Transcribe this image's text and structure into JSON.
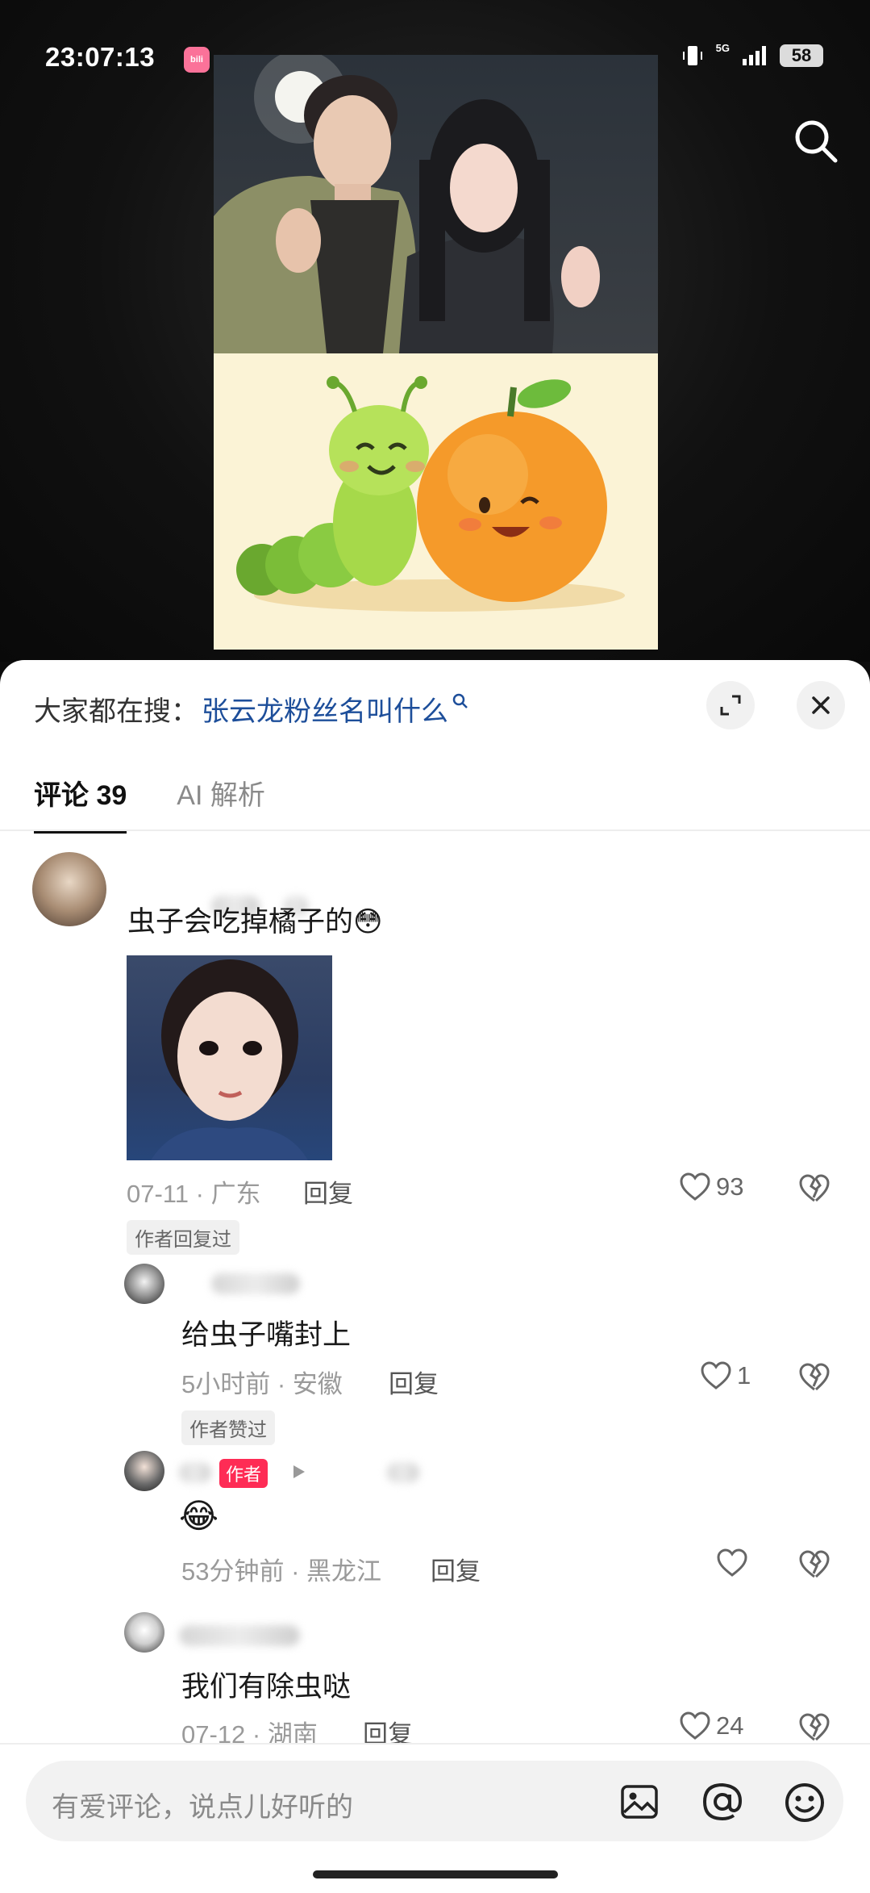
{
  "status_bar": {
    "time": "23:07:13",
    "app_badge": "bili",
    "network": "5G",
    "battery": "58"
  },
  "panel": {
    "trending_label": "大家都在搜：",
    "trending_query": "张云龙粉丝名叫什么"
  },
  "tabs": [
    {
      "label": "评论 39",
      "active": true
    },
    {
      "label": "AI 解析",
      "active": false
    }
  ],
  "comments": [
    {
      "text": "虫子会吃掉橘子的",
      "emoji": "😳",
      "time": "07-11",
      "location": "广东",
      "reply_label": "回复",
      "likes": "93",
      "tag": "作者回复过"
    }
  ],
  "replies": [
    {
      "text": "给虫子嘴封上",
      "time": "5小时前",
      "location": "安徽",
      "reply_label": "回复",
      "likes": "1",
      "tag": "作者赞过"
    },
    {
      "author_tag": "作者",
      "emoji": "😂",
      "time": "53分钟前",
      "location": "黑龙江",
      "reply_label": "回复",
      "likes": ""
    },
    {
      "text": "我们有除虫哒",
      "time": "07-12",
      "location": "湖南",
      "reply_label": "回复",
      "likes": "24"
    }
  ],
  "input": {
    "placeholder": "有爱评论，说点儿好听的"
  },
  "icons": {
    "search": "search-icon",
    "expand": "expand-icon",
    "close": "close-icon",
    "like": "heart-icon",
    "dislike": "broken-heart-icon",
    "image": "image-icon",
    "mention": "at-icon",
    "emoji": "emoji-icon"
  },
  "colors": {
    "accent": "#fe2c55",
    "link": "#1d4e9a",
    "badge": "#fb7299"
  }
}
